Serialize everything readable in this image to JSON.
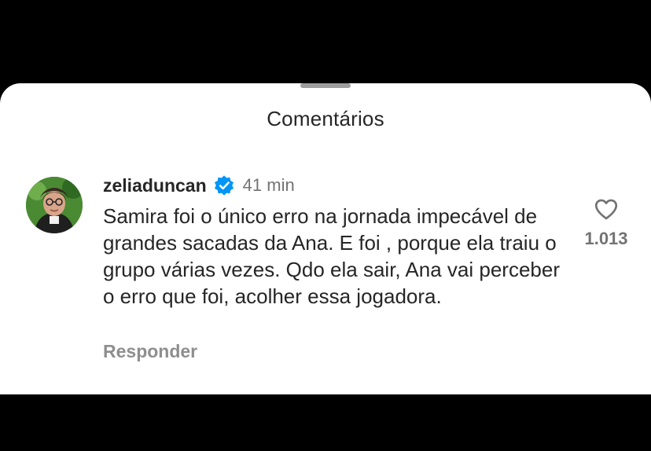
{
  "sheet": {
    "title": "Comentários"
  },
  "comment": {
    "username": "zeliaduncan",
    "time": "41 min",
    "text": "Samira foi o único erro na jornada impecável de grandes sacadas da Ana. E foi , porque ela traiu o grupo várias vezes. Qdo ela sair, Ana vai perceber o erro que foi, acolher essa jogadora.",
    "reply_label": "Responder",
    "like_count": "1.013"
  },
  "colors": {
    "verified": "#0095f6",
    "text": "#262626",
    "muted": "#737373"
  },
  "icons": {
    "verified": "verified-badge-icon",
    "like": "heart-outline-icon"
  }
}
